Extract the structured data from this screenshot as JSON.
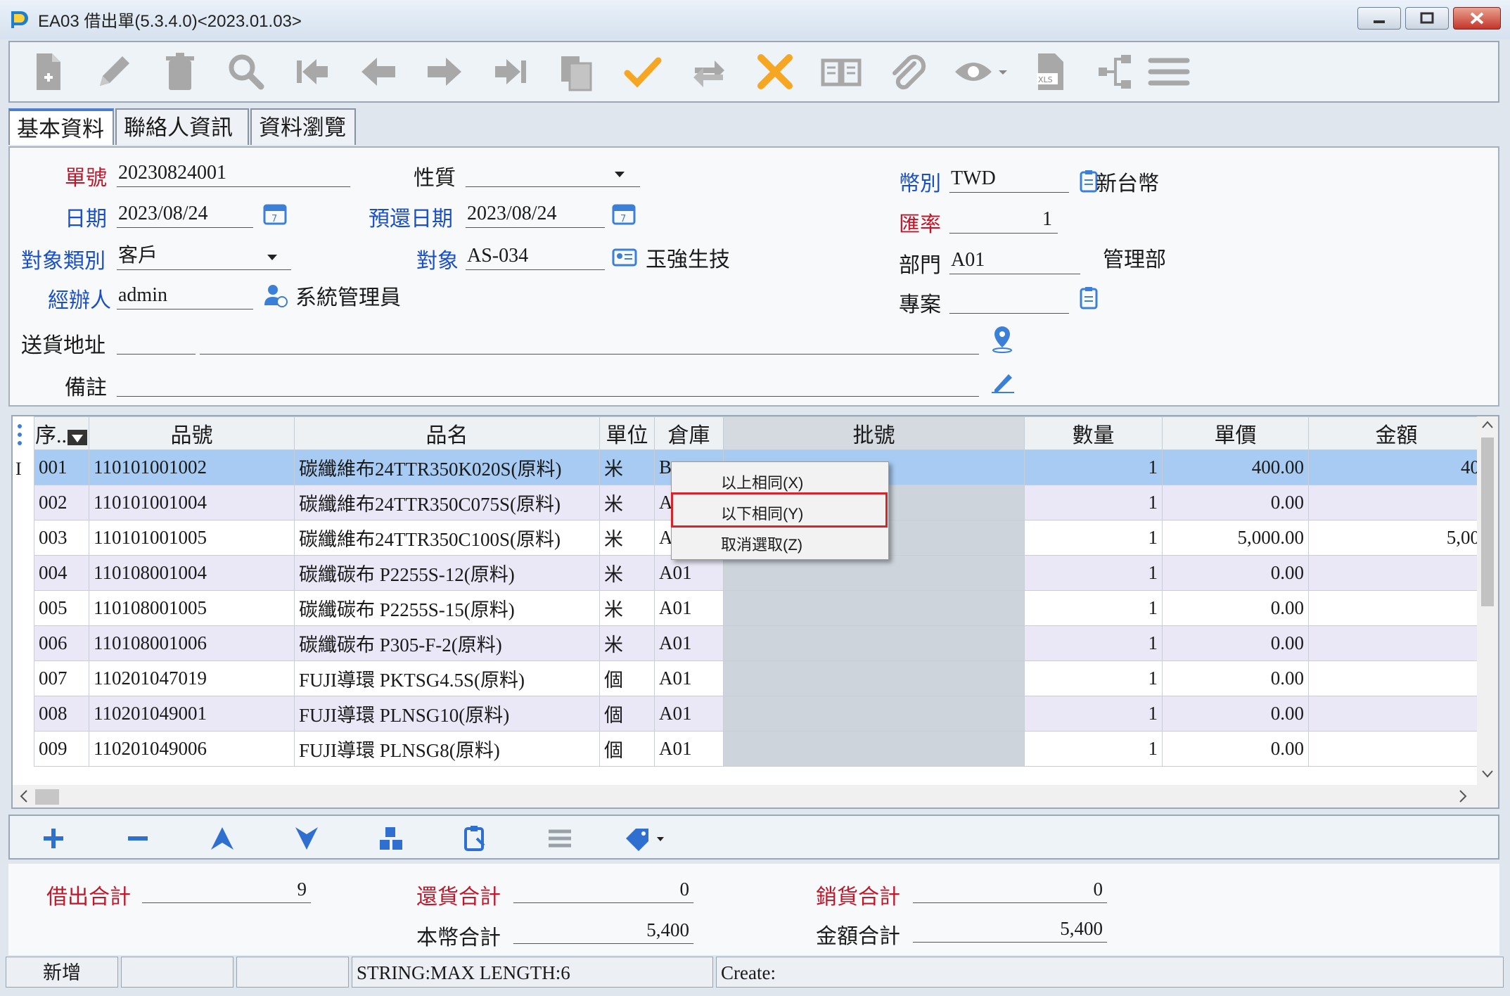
{
  "window": {
    "title": "EA03 借出單(5.3.4.0)<2023.01.03>"
  },
  "toolbar": {
    "icons": [
      "new-doc-icon",
      "edit-icon",
      "delete-icon",
      "search-icon",
      "first-record-icon",
      "prev-record-icon",
      "next-record-icon",
      "last-record-icon",
      "copy-icon",
      "confirm-icon",
      "transfer-icon",
      "cancel-icon",
      "open-book-icon",
      "attachment-icon",
      "preview-icon",
      "excel-icon",
      "workflow-icon",
      "menu-icon"
    ]
  },
  "tabs": [
    {
      "label": "基本資料"
    },
    {
      "label": "聯絡人資訊"
    },
    {
      "label": "資料瀏覽"
    }
  ],
  "form": {
    "doc_no": {
      "label": "單號",
      "value": "20230824001"
    },
    "nature": {
      "label": "性質",
      "value": ""
    },
    "currency": {
      "label": "幣別",
      "value": "TWD",
      "desc": "新台幣"
    },
    "date": {
      "label": "日期",
      "value": "2023/08/24"
    },
    "return_date": {
      "label": "預還日期",
      "value": "2023/08/24"
    },
    "rate": {
      "label": "匯率",
      "value": "1"
    },
    "target_type": {
      "label": "對象類別",
      "value": "客戶"
    },
    "target": {
      "label": "對象",
      "value": "AS-034",
      "desc": "玉強生技"
    },
    "dept": {
      "label": "部門",
      "value": "A01",
      "desc": "管理部"
    },
    "handler": {
      "label": "經辦人",
      "value": "admin",
      "desc": "系統管理員"
    },
    "project": {
      "label": "專案",
      "value": ""
    },
    "address": {
      "label": "送貨地址",
      "value": ""
    },
    "memo": {
      "label": "備註",
      "value": ""
    }
  },
  "grid": {
    "headers": {
      "seq": "序..",
      "item_no": "品號",
      "item_name": "品名",
      "unit": "單位",
      "warehouse": "倉庫",
      "lot": "批號",
      "qty": "數量",
      "price": "單價",
      "amount": "金額"
    },
    "rows": [
      {
        "seq": "001",
        "item_no": "110101001002",
        "item_name": "碳纖維布24TTR350K020S(原料)",
        "unit": "米",
        "warehouse": "B",
        "lot": "",
        "qty": "1",
        "price": "400.00",
        "amount": "40"
      },
      {
        "seq": "002",
        "item_no": "110101001004",
        "item_name": "碳纖維布24TTR350C075S(原料)",
        "unit": "米",
        "warehouse": "A",
        "lot": "",
        "qty": "1",
        "price": "0.00",
        "amount": ""
      },
      {
        "seq": "003",
        "item_no": "110101001005",
        "item_name": "碳纖維布24TTR350C100S(原料)",
        "unit": "米",
        "warehouse": "A",
        "lot": "",
        "qty": "1",
        "price": "5,000.00",
        "amount": "5,00"
      },
      {
        "seq": "004",
        "item_no": "110108001004",
        "item_name": "碳纖碳布 P2255S-12(原料)",
        "unit": "米",
        "warehouse": "A01",
        "lot": "",
        "qty": "1",
        "price": "0.00",
        "amount": ""
      },
      {
        "seq": "005",
        "item_no": "110108001005",
        "item_name": "碳纖碳布 P2255S-15(原料)",
        "unit": "米",
        "warehouse": "A01",
        "lot": "",
        "qty": "1",
        "price": "0.00",
        "amount": ""
      },
      {
        "seq": "006",
        "item_no": "110108001006",
        "item_name": "碳纖碳布 P305-F-2(原料)",
        "unit": "米",
        "warehouse": "A01",
        "lot": "",
        "qty": "1",
        "price": "0.00",
        "amount": ""
      },
      {
        "seq": "007",
        "item_no": "110201047019",
        "item_name": "FUJI導環 PKTSG4.5S(原料)",
        "unit": "個",
        "warehouse": "A01",
        "lot": "",
        "qty": "1",
        "price": "0.00",
        "amount": ""
      },
      {
        "seq": "008",
        "item_no": "110201049001",
        "item_name": "FUJI導環 PLNSG10(原料)",
        "unit": "個",
        "warehouse": "A01",
        "lot": "",
        "qty": "1",
        "price": "0.00",
        "amount": ""
      },
      {
        "seq": "009",
        "item_no": "110201049006",
        "item_name": "FUJI導環 PLNSG8(原料)",
        "unit": "個",
        "warehouse": "A01",
        "lot": "",
        "qty": "1",
        "price": "0.00",
        "amount": ""
      }
    ]
  },
  "context_menu": {
    "items": [
      {
        "label": "以上相同(X)"
      },
      {
        "label": "以下相同(Y)"
      },
      {
        "label": "取消選取(Z)"
      }
    ],
    "highlighted": "以下相同(Y)"
  },
  "bottom_toolbar": {
    "icons": [
      "add-row-icon",
      "remove-row-icon",
      "move-up-icon",
      "move-down-icon",
      "blocks-icon",
      "paste-icon",
      "list-icon",
      "tag-icon"
    ]
  },
  "totals": {
    "lend_total": {
      "label": "借出合計",
      "value": "9"
    },
    "return_total": {
      "label": "還貨合計",
      "value": "0"
    },
    "sales_total": {
      "label": "銷貨合計",
      "value": "0"
    },
    "local_total": {
      "label": "本幣合計",
      "value": "5,400"
    },
    "amount_total": {
      "label": "金額合計",
      "value": "5,400"
    }
  },
  "status": {
    "mode": "新增",
    "info": "STRING:MAX LENGTH:6",
    "create": "Create:"
  }
}
